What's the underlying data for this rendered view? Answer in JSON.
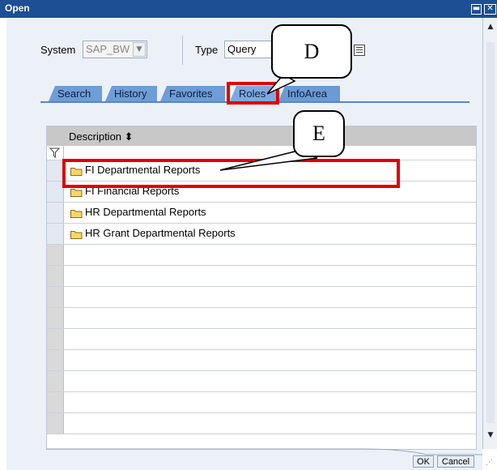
{
  "window": {
    "title": "Open"
  },
  "filters": {
    "system_label": "System",
    "system_value": "SAP_BW",
    "type_label": "Type",
    "type_value": "Query"
  },
  "tabs": [
    {
      "label": "Search"
    },
    {
      "label": "History"
    },
    {
      "label": "Favorites"
    },
    {
      "label": "Roles"
    },
    {
      "label": "InfoArea"
    }
  ],
  "active_tab": "Roles",
  "table": {
    "header": "Description ⬍",
    "rows": [
      {
        "label": "FI Departmental Reports"
      },
      {
        "label": "FI Financial Reports"
      },
      {
        "label": "HR Departmental Reports"
      },
      {
        "label": "HR Grant Departmental Reports"
      }
    ],
    "empty_rows": 9
  },
  "buttons": {
    "ok": "OK",
    "cancel": "Cancel"
  },
  "annotations": {
    "callout_d": "D",
    "callout_e": "E"
  },
  "colors": {
    "titlebar": "#1c4f93",
    "tab": "#6f9dd6",
    "highlight": "#e10000"
  },
  "icons": [
    "minimize-icon",
    "close-icon",
    "dropdown-icon",
    "list-icon",
    "filter-icon",
    "folder-icon",
    "sort-icon",
    "scroll-up-icon",
    "scroll-down-icon",
    "resize-grip-icon"
  ]
}
